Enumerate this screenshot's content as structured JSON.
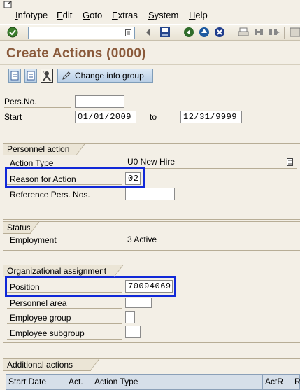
{
  "menu": {
    "items": [
      "Infotype",
      "Edit",
      "Goto",
      "Extras",
      "System",
      "Help"
    ]
  },
  "toolbar": {
    "command_value": ""
  },
  "title": "Create Actions (0000)",
  "app_toolbar": {
    "change_info_group_label": "Change info group"
  },
  "header": {
    "pers_no_label": "Pers.No.",
    "pers_no_value": "",
    "start_label": "Start",
    "start_value": "01/01/2009",
    "to_label": "to",
    "end_value": "12/31/9999"
  },
  "personnel_action": {
    "group_label": "Personnel action",
    "action_type_label": "Action Type",
    "action_type_value": "U0 New Hire",
    "reason_label": "Reason for Action",
    "reason_value": "02",
    "reference_label": "Reference Pers. Nos.",
    "reference_value": ""
  },
  "status": {
    "group_label": "Status",
    "employment_label": "Employment",
    "employment_value": "3 Active"
  },
  "org_assignment": {
    "group_label": "Organizational assignment",
    "position_label": "Position",
    "position_value": "70094069",
    "personnel_area_label": "Personnel area",
    "personnel_area_value": "",
    "employee_group_label": "Employee group",
    "employee_group_value": "",
    "employee_subgroup_label": "Employee subgroup",
    "employee_subgroup_value": ""
  },
  "additional_actions": {
    "group_label": "Additional actions",
    "columns": [
      "Start Date",
      "Act.",
      "Action Type",
      "ActR",
      "R"
    ]
  },
  "colors": {
    "highlight": "#1028d8",
    "title": "#8a5a3b",
    "background": "#f3efe6"
  }
}
